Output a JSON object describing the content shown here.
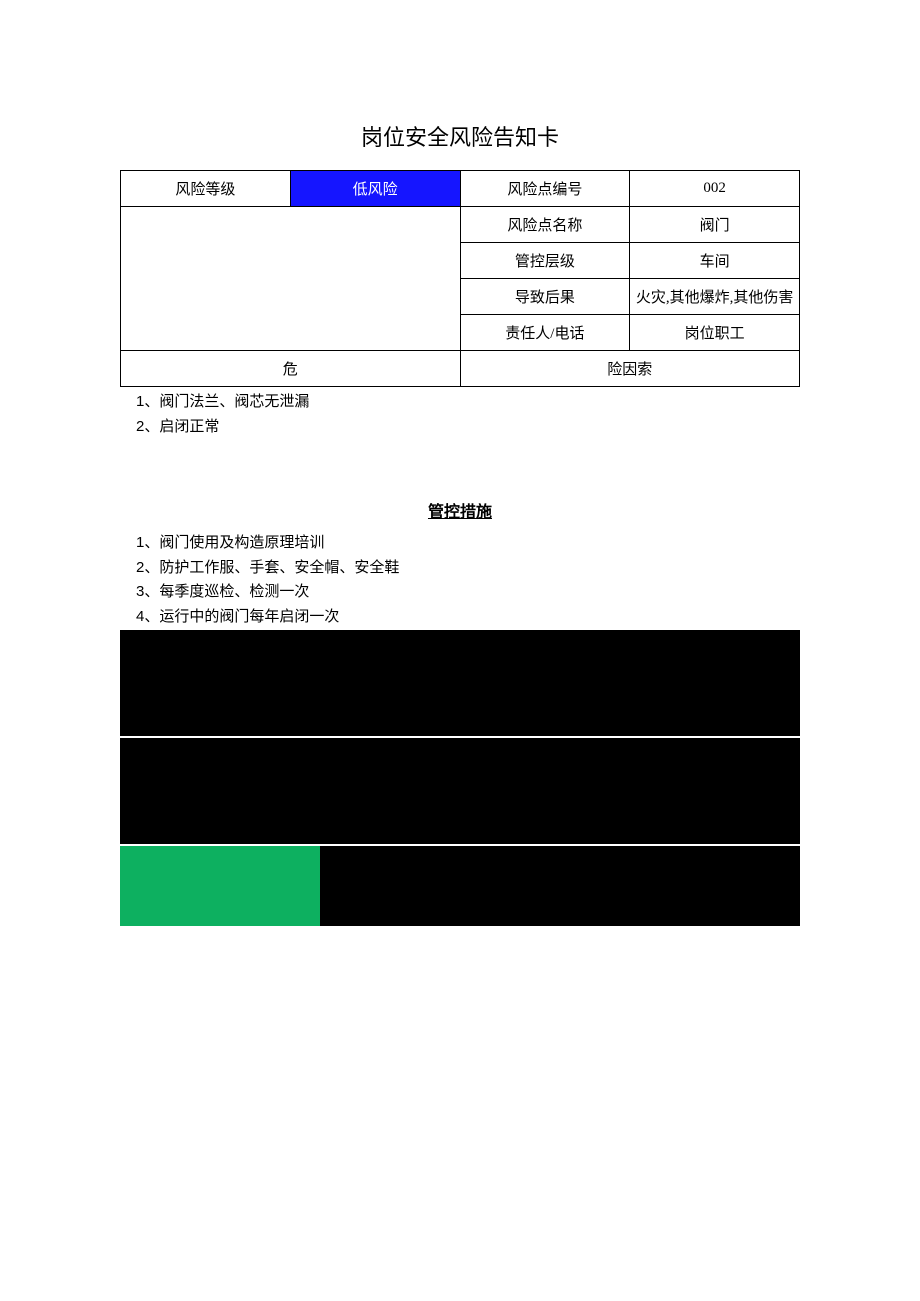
{
  "title": "岗位安全风险告知卡",
  "labels": {
    "riskGrade": "风险等级",
    "riskLevel": "低风险",
    "riskPointNo": "风险点编号",
    "riskPointName": "风险点名称",
    "controlLevel": "管控层级",
    "consequence": "导致后果",
    "responsible": "责任人/电话",
    "hazardHeaderLeft": "危",
    "hazardHeaderRight": "险因索"
  },
  "values": {
    "riskPointNo": "002",
    "riskPointName": "阀门",
    "controlLevel": "车间",
    "consequence": "火灾,其他爆炸,其他伤害",
    "responsible": "岗位职工"
  },
  "hazards": [
    "1、阀门法兰、阀芯无泄漏",
    "2、启闭正常"
  ],
  "measuresTitle": "管控措施",
  "measures": [
    "1、阀门使用及构造原理培训",
    "2、防护工作服、手套、安全帽、安全鞋",
    "3、每季度巡检、检测一次",
    "4、运行中的阀门每年启闭一次"
  ],
  "colors": {
    "riskBlue": "#1515ff",
    "green": "#0db060",
    "black": "#000000"
  }
}
